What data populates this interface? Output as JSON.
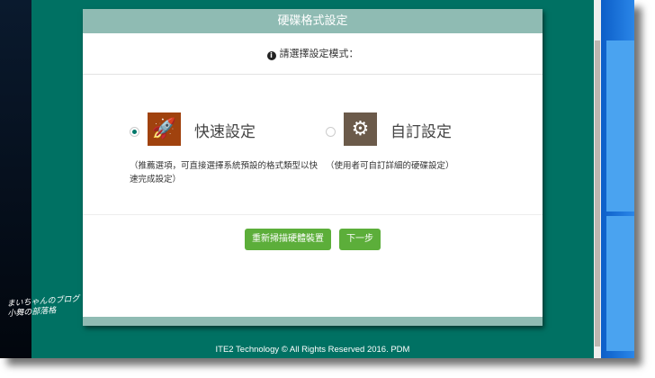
{
  "modal": {
    "title": "硬碟格式設定",
    "prompt": "請選擇設定模式：",
    "options": [
      {
        "label": "快速設定",
        "description": "（推薦選項，可直接選擇系統預設的格式類型以快速完成設定）",
        "selected": true,
        "icon": "rocket-icon",
        "color": "#a0420e"
      },
      {
        "label": "自訂設定",
        "description": "（使用者可自訂詳細的硬碟設定）",
        "selected": false,
        "icon": "gears-icon",
        "color": "#6b5a4a"
      }
    ],
    "buttons": {
      "rescan": "重新掃描硬體裝置",
      "next": "下一步"
    }
  },
  "footer": "ITE2 Technology © All Rights Reserved 2016. PDM",
  "watermark": "まいちゃんのブログ 小舞の部落格"
}
